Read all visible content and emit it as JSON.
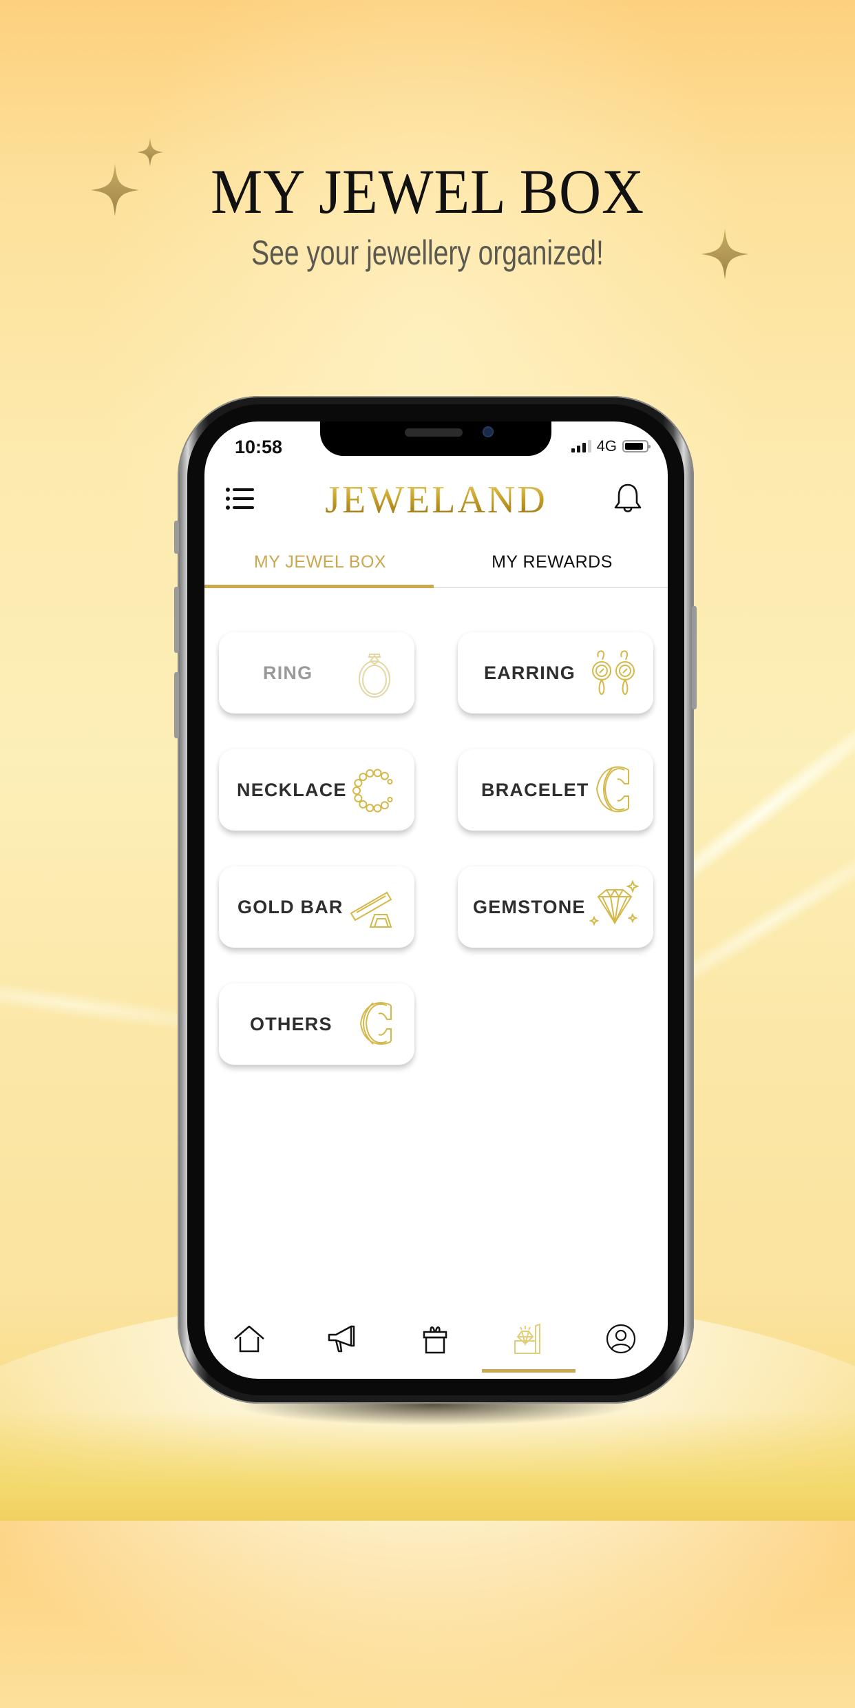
{
  "promo": {
    "headline": "MY JEWEL BOX",
    "subline": "See your jewellery organized!"
  },
  "status_bar": {
    "time": "10:58",
    "network": "4G",
    "signal_bars": 3,
    "signal_bars_max": 4,
    "battery_level": 0.85
  },
  "header": {
    "logo": "JEWELAND",
    "menu_icon": "list-menu-icon",
    "notification_icon": "bell-icon"
  },
  "tabs": [
    {
      "label": "MY JEWEL BOX",
      "active": true
    },
    {
      "label": "MY REWARDS",
      "active": false
    }
  ],
  "categories": [
    {
      "label": "RING",
      "icon": "ring-icon",
      "muted": true
    },
    {
      "label": "EARRING",
      "icon": "earring-icon",
      "muted": false
    },
    {
      "label": "NECKLACE",
      "icon": "necklace-icon",
      "muted": false
    },
    {
      "label": "BRACELET",
      "icon": "bracelet-icon",
      "muted": false
    },
    {
      "label": "GOLD BAR",
      "icon": "gold-bar-icon",
      "muted": false
    },
    {
      "label": "GEMSTONE",
      "icon": "gemstone-icon",
      "muted": false
    },
    {
      "label": "OTHERS",
      "icon": "bangle-icon",
      "muted": false
    }
  ],
  "bottom_nav": [
    {
      "name": "home",
      "icon": "home-icon",
      "active": false
    },
    {
      "name": "promotions",
      "icon": "megaphone-icon",
      "active": false
    },
    {
      "name": "rewards",
      "icon": "gift-icon",
      "active": false
    },
    {
      "name": "jewel-box",
      "icon": "jewel-box-icon",
      "active": true
    },
    {
      "name": "profile",
      "icon": "user-icon",
      "active": false
    }
  ],
  "colors": {
    "accent_gold": "#c9a84f",
    "icon_gold": "#d4b84a",
    "text_dark": "#2e2e2e",
    "text_muted": "#9a9a9a",
    "bg_top": "#fdd07e",
    "bg_bottom": "#f0d060"
  }
}
